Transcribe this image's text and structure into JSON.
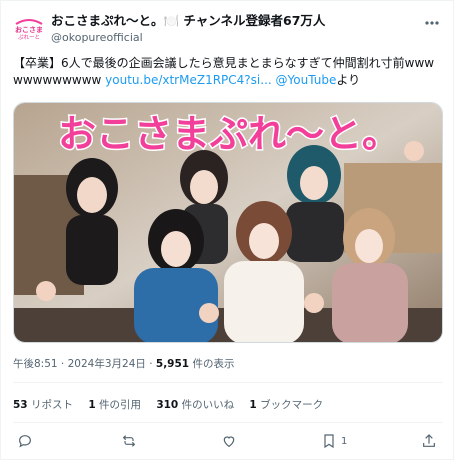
{
  "account": {
    "display_name": "おこさまぷれ～と。🍽️ チャンネル登録者67万人",
    "handle": "@okopureofficial",
    "avatar_text": "おこさまぷれーと"
  },
  "tweet": {
    "text_lead": "【卒業】6人で最後の企画会議したら意見まとまらなすぎて仲間割れ寸前wwwwwwwwwwww ",
    "link": "youtu.be/xtrMeZ1RPC4?si...",
    "text_mid": " ",
    "mention": "@YouTube",
    "text_tail": "より"
  },
  "media": {
    "title": "おこさまぷれ～と。"
  },
  "meta": {
    "time": "午後8:51",
    "date": "2024年3月24日",
    "views_count": "5,951",
    "views_label": " 件の表示"
  },
  "stats": {
    "reposts_count": "53",
    "reposts_label": " リポスト",
    "quotes_count": "1",
    "quotes_label": " 件の引用",
    "likes_count": "310",
    "likes_label": " 件のいいね",
    "bookmarks_count": "1",
    "bookmarks_label": " ブックマーク"
  },
  "actions": {
    "bookmark_count": "1"
  },
  "colors": {
    "link": "#1d9bf0",
    "text": "#0f1419",
    "muted": "#536471",
    "brand_pink": "#f2409a"
  },
  "icons": [
    "more-icon",
    "reply-icon",
    "repost-icon",
    "like-icon",
    "bookmark-icon",
    "share-icon"
  ]
}
